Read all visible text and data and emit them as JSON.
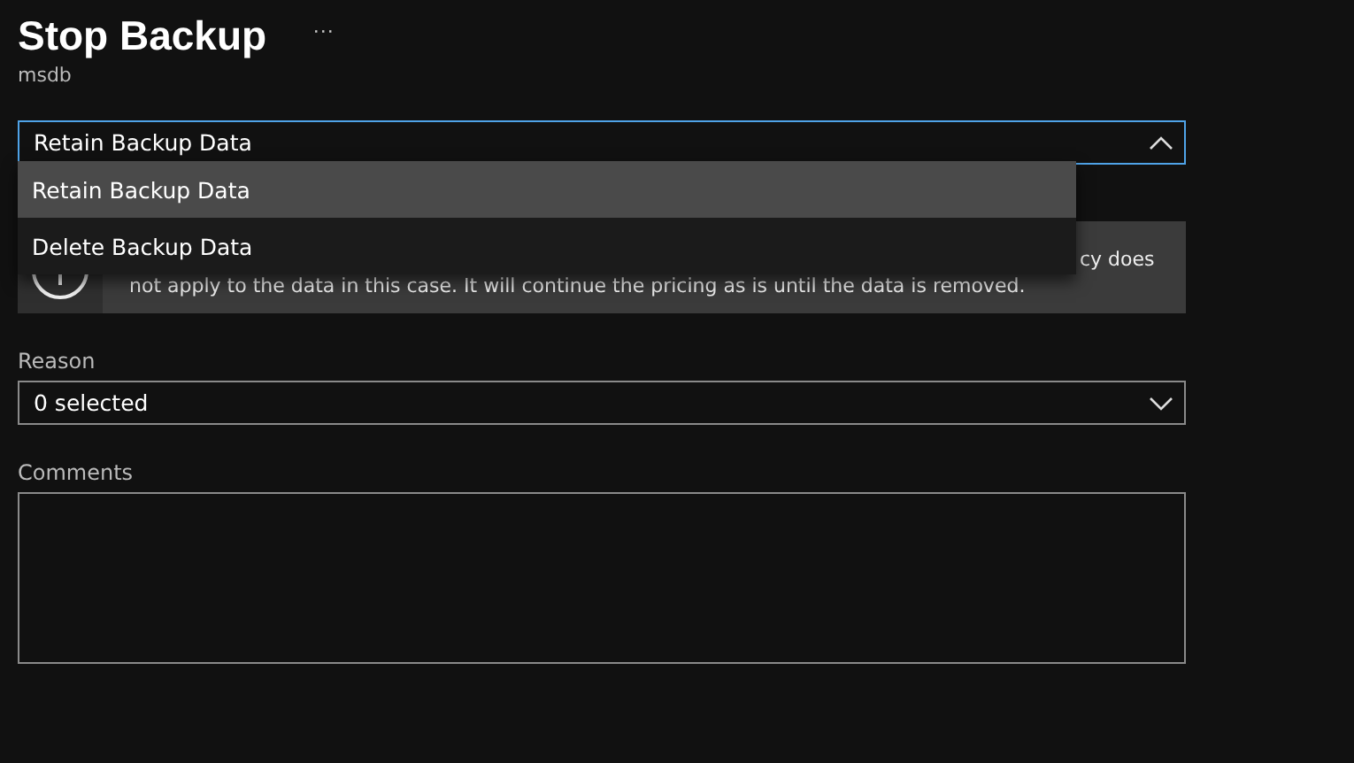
{
  "header": {
    "title": "Stop Backup",
    "more": "···",
    "subtitle": "msdb"
  },
  "action_dropdown": {
    "value": "Retain Backup Data",
    "expanded": true,
    "options": [
      {
        "label": "Retain Backup Data",
        "selected": true
      },
      {
        "label": "Delete Backup Data",
        "selected": false
      }
    ]
  },
  "info_banner": {
    "line_1": "cy does",
    "line_2": "not apply to the data in this case. It will continue the pricing as is until the data is removed."
  },
  "reason": {
    "label": "Reason",
    "value": "0 selected"
  },
  "comments": {
    "label": "Comments"
  }
}
